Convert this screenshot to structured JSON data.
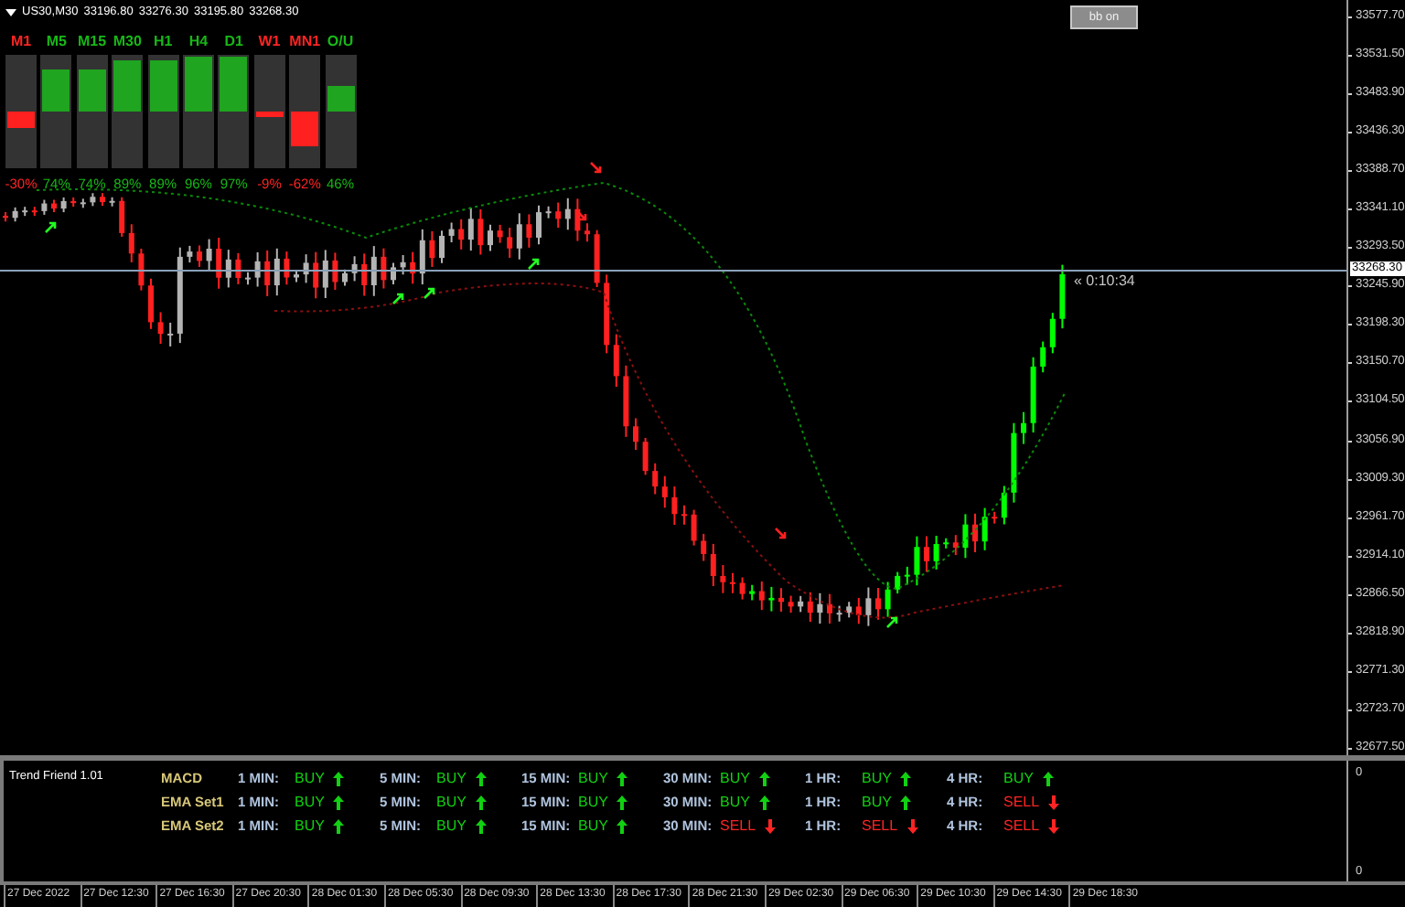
{
  "chart": {
    "title": "US30,M30",
    "quotes": [
      "33196.80",
      "33276.30",
      "33195.80",
      "33268.30"
    ],
    "button": "bb on",
    "countdown": "« 0:10:34",
    "current_price": "33268.30",
    "price_axis": [
      "33577.70",
      "33531.50",
      "33483.90",
      "33436.30",
      "33388.70",
      "33341.10",
      "33293.50",
      "33245.90",
      "33198.30",
      "33150.70",
      "33104.50",
      "33056.90",
      "33009.30",
      "32961.70",
      "32914.10",
      "32866.50",
      "32818.90",
      "32771.30",
      "32723.70",
      "32677.50"
    ]
  },
  "strength_meter": [
    {
      "label": "M1",
      "bullish": false,
      "level": 0.3,
      "reading": "-30%"
    },
    {
      "label": "M5",
      "bullish": true,
      "level": 0.74,
      "reading": "74%"
    },
    {
      "label": "M15",
      "bullish": true,
      "level": 0.74,
      "reading": "74%"
    },
    {
      "label": "M30",
      "bullish": true,
      "level": 0.89,
      "reading": "89%"
    },
    {
      "label": "H1",
      "bullish": true,
      "level": 0.89,
      "reading": "89%"
    },
    {
      "label": "H4",
      "bullish": true,
      "level": 0.96,
      "reading": "96%"
    },
    {
      "label": "D1",
      "bullish": true,
      "level": 0.97,
      "reading": "97%"
    },
    {
      "label": "W1",
      "bullish": false,
      "level": 0.09,
      "reading": "-9%"
    },
    {
      "label": "MN1",
      "bullish": false,
      "level": 0.62,
      "reading": "-62%"
    },
    {
      "label": "O/U",
      "bullish": true,
      "level": 0.46,
      "reading": "46%"
    }
  ],
  "indicator": {
    "title": "Trend Friend 1.01",
    "axis": [
      "0",
      "0"
    ],
    "rows": [
      {
        "name": "MACD",
        "signals": [
          {
            "period": "1 MIN:",
            "signal": "BUY",
            "bullish": true
          },
          {
            "period": "5 MIN:",
            "signal": "BUY",
            "bullish": true
          },
          {
            "period": "15 MIN:",
            "signal": "BUY",
            "bullish": true
          },
          {
            "period": "30 MIN:",
            "signal": "BUY",
            "bullish": true
          },
          {
            "period": "1 HR:",
            "signal": "BUY",
            "bullish": true
          },
          {
            "period": "4 HR:",
            "signal": "BUY",
            "bullish": true
          }
        ]
      },
      {
        "name": "EMA Set1",
        "signals": [
          {
            "period": "1 MIN:",
            "signal": "BUY",
            "bullish": true
          },
          {
            "period": "5 MIN:",
            "signal": "BUY",
            "bullish": true
          },
          {
            "period": "15 MIN:",
            "signal": "BUY",
            "bullish": true
          },
          {
            "period": "30 MIN:",
            "signal": "BUY",
            "bullish": true
          },
          {
            "period": "1 HR:",
            "signal": "BUY",
            "bullish": true
          },
          {
            "period": "4 HR:",
            "signal": "SELL",
            "bullish": false
          }
        ]
      },
      {
        "name": "EMA Set2",
        "signals": [
          {
            "period": "1 MIN:",
            "signal": "BUY",
            "bullish": true
          },
          {
            "period": "5 MIN:",
            "signal": "BUY",
            "bullish": true
          },
          {
            "period": "15 MIN:",
            "signal": "BUY",
            "bullish": true
          },
          {
            "period": "30 MIN:",
            "signal": "SELL",
            "bullish": false
          },
          {
            "period": "1 HR:",
            "signal": "SELL",
            "bullish": false
          },
          {
            "period": "4 HR:",
            "signal": "SELL",
            "bullish": false
          }
        ]
      }
    ]
  },
  "time_axis": [
    "27 Dec 2022",
    "27 Dec 12:30",
    "27 Dec 16:30",
    "27 Dec 20:30",
    "28 Dec 01:30",
    "28 Dec 05:30",
    "28 Dec 09:30",
    "28 Dec 13:30",
    "28 Dec 17:30",
    "28 Dec 21:30",
    "29 Dec 02:30",
    "29 Dec 06:30",
    "29 Dec 10:30",
    "29 Dec 14:30",
    "29 Dec 18:30"
  ]
}
